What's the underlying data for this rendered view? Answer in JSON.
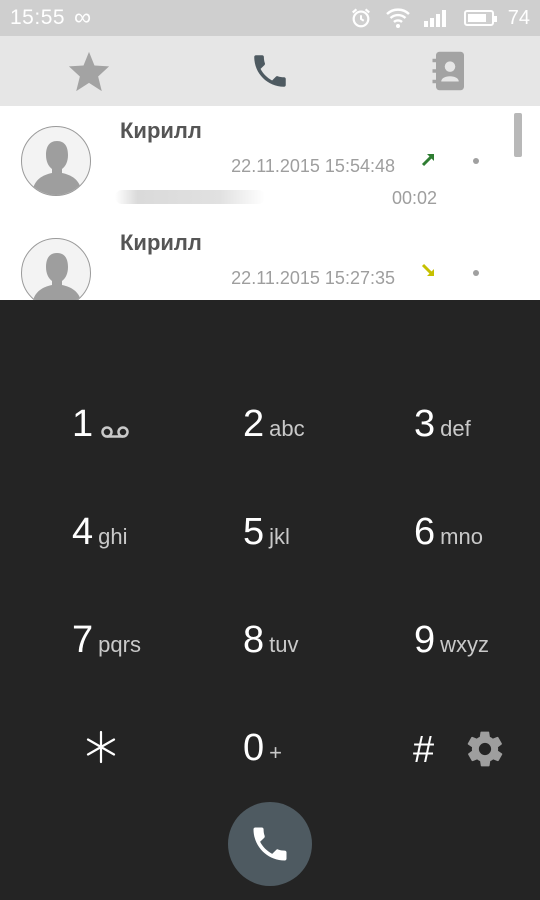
{
  "status_bar": {
    "time": "15:55",
    "battery_level": "74",
    "infinity_symbol": "∞"
  },
  "tabs": [
    {
      "name": "favorites",
      "icon": "star-icon"
    },
    {
      "name": "phone",
      "icon": "phone-icon"
    },
    {
      "name": "contacts",
      "icon": "contacts-book-icon"
    }
  ],
  "call_log": [
    {
      "name": "Кирилл",
      "datetime": "22.11.2015 15:54:48",
      "duration": "00:02",
      "direction": "outgoing",
      "direction_color": "#2e7d32"
    },
    {
      "name": "Кирилл",
      "datetime": "22.11.2015 15:27:35",
      "direction": "incoming",
      "direction_color": "#c6c000"
    }
  ],
  "dialpad": {
    "keys": [
      {
        "digit": "1",
        "letters": ""
      },
      {
        "digit": "2",
        "letters": "abc"
      },
      {
        "digit": "3",
        "letters": "def"
      },
      {
        "digit": "4",
        "letters": "ghi"
      },
      {
        "digit": "5",
        "letters": "jkl"
      },
      {
        "digit": "6",
        "letters": "mno"
      },
      {
        "digit": "7",
        "letters": "pqrs"
      },
      {
        "digit": "8",
        "letters": "tuv"
      },
      {
        "digit": "9",
        "letters": "wxyz"
      },
      {
        "digit": "0",
        "letters": "+"
      }
    ],
    "hash": "#"
  },
  "colors": {
    "status_bar": "#cfcfcf",
    "tab_bar": "#e6e6e6",
    "active_tab_icon": "#4e5a61",
    "dialpad_bg": "#242424",
    "call_button": "#4e5a61"
  }
}
